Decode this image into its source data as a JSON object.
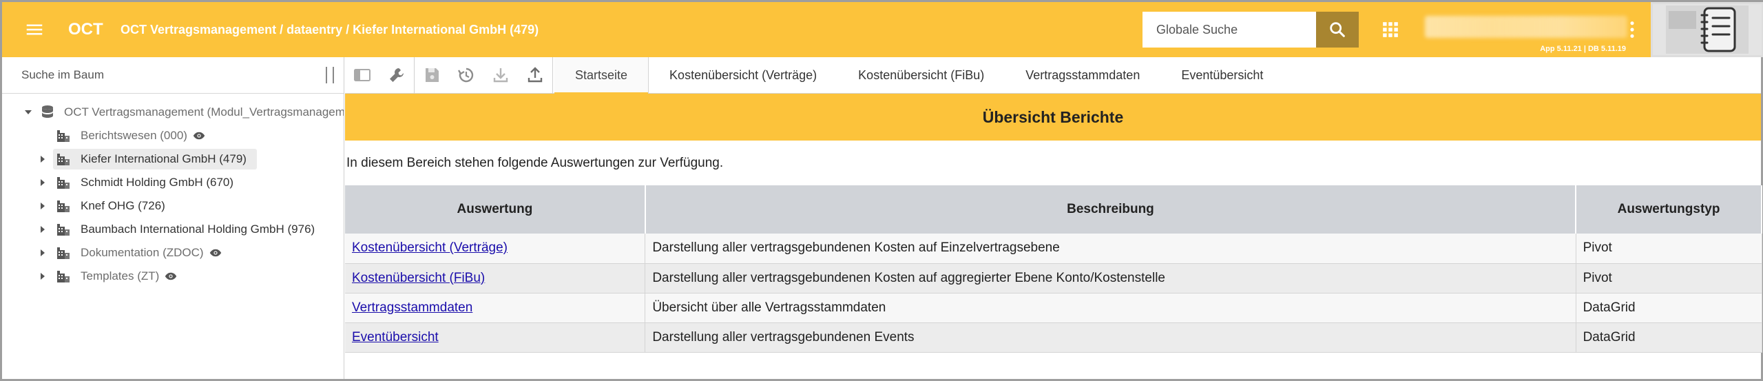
{
  "header": {
    "app_name": "OCT",
    "breadcrumb": "OCT Vertragsmanagement / dataentry / Kiefer International GmbH (479)",
    "search_placeholder": "Globale Suche",
    "version": "App 5.11.21 | DB 5.11.19",
    "accent_color": "#fcc33b"
  },
  "tree": {
    "search_placeholder": "Suche im Baum",
    "nodes": [
      {
        "label": "OCT Vertragsmanagement (Modul_Vertragsmanagement)",
        "toggle": "expanded",
        "icon": "database-icon",
        "muted": true
      },
      {
        "label": "Berichtswesen (000)",
        "toggle": "none",
        "icon": "building-icon",
        "muted": true,
        "eye": true
      },
      {
        "label": "Kiefer International GmbH (479)",
        "toggle": "collapsed",
        "icon": "building-icon",
        "muted": false,
        "selected": true
      },
      {
        "label": "Schmidt Holding GmbH (670)",
        "toggle": "collapsed",
        "icon": "building-icon",
        "muted": false
      },
      {
        "label": "Knef OHG (726)",
        "toggle": "collapsed",
        "icon": "building-icon",
        "muted": false
      },
      {
        "label": "Baumbach International Holding GmbH (976)",
        "toggle": "collapsed",
        "icon": "building-icon",
        "muted": false
      },
      {
        "label": "Dokumentation (ZDOC)",
        "toggle": "collapsed",
        "icon": "building-icon",
        "muted": true,
        "eye": true
      },
      {
        "label": "Templates (ZT)",
        "toggle": "collapsed",
        "icon": "building-icon",
        "muted": true,
        "eye": true
      }
    ]
  },
  "tabs": [
    {
      "label": "Startseite",
      "active": true
    },
    {
      "label": "Kostenübersicht (Verträge)"
    },
    {
      "label": "Kostenübersicht (FiBu)"
    },
    {
      "label": "Vertragsstammdaten"
    },
    {
      "label": "Eventübersicht"
    }
  ],
  "report": {
    "title": "Übersicht Berichte",
    "intro": "In diesem Bereich stehen folgende Auswertungen zur Verfügung.",
    "columns": [
      "Auswertung",
      "Beschreibung",
      "Auswertungstyp"
    ],
    "rows": [
      {
        "name": "Kostenübersicht (Verträge)",
        "description": "Darstellung aller vertragsgebundenen Kosten auf Einzelvertragsebene",
        "type": "Pivot"
      },
      {
        "name": "Kostenübersicht (FiBu)",
        "description": "Darstellung aller vertragsgebundenen Kosten auf aggregierter Ebene Konto/Kostenstelle",
        "type": "Pivot"
      },
      {
        "name": "Vertragsstammdaten",
        "description": "Übersicht über alle Vertragsstammdaten",
        "type": "DataGrid"
      },
      {
        "name": "Eventübersicht",
        "description": "Darstellung aller vertragsgebundenen Events",
        "type": "DataGrid"
      }
    ]
  }
}
